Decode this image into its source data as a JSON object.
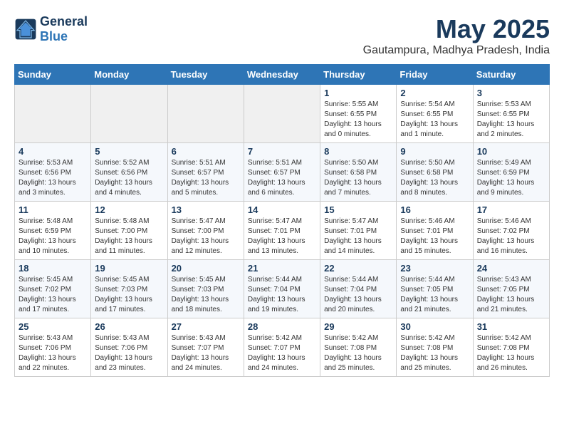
{
  "header": {
    "logo_line1": "General",
    "logo_line2": "Blue",
    "month": "May 2025",
    "location": "Gautampura, Madhya Pradesh, India"
  },
  "weekdays": [
    "Sunday",
    "Monday",
    "Tuesday",
    "Wednesday",
    "Thursday",
    "Friday",
    "Saturday"
  ],
  "weeks": [
    [
      {
        "day": "",
        "info": ""
      },
      {
        "day": "",
        "info": ""
      },
      {
        "day": "",
        "info": ""
      },
      {
        "day": "",
        "info": ""
      },
      {
        "day": "1",
        "info": "Sunrise: 5:55 AM\nSunset: 6:55 PM\nDaylight: 13 hours\nand 0 minutes."
      },
      {
        "day": "2",
        "info": "Sunrise: 5:54 AM\nSunset: 6:55 PM\nDaylight: 13 hours\nand 1 minute."
      },
      {
        "day": "3",
        "info": "Sunrise: 5:53 AM\nSunset: 6:55 PM\nDaylight: 13 hours\nand 2 minutes."
      }
    ],
    [
      {
        "day": "4",
        "info": "Sunrise: 5:53 AM\nSunset: 6:56 PM\nDaylight: 13 hours\nand 3 minutes."
      },
      {
        "day": "5",
        "info": "Sunrise: 5:52 AM\nSunset: 6:56 PM\nDaylight: 13 hours\nand 4 minutes."
      },
      {
        "day": "6",
        "info": "Sunrise: 5:51 AM\nSunset: 6:57 PM\nDaylight: 13 hours\nand 5 minutes."
      },
      {
        "day": "7",
        "info": "Sunrise: 5:51 AM\nSunset: 6:57 PM\nDaylight: 13 hours\nand 6 minutes."
      },
      {
        "day": "8",
        "info": "Sunrise: 5:50 AM\nSunset: 6:58 PM\nDaylight: 13 hours\nand 7 minutes."
      },
      {
        "day": "9",
        "info": "Sunrise: 5:50 AM\nSunset: 6:58 PM\nDaylight: 13 hours\nand 8 minutes."
      },
      {
        "day": "10",
        "info": "Sunrise: 5:49 AM\nSunset: 6:59 PM\nDaylight: 13 hours\nand 9 minutes."
      }
    ],
    [
      {
        "day": "11",
        "info": "Sunrise: 5:48 AM\nSunset: 6:59 PM\nDaylight: 13 hours\nand 10 minutes."
      },
      {
        "day": "12",
        "info": "Sunrise: 5:48 AM\nSunset: 7:00 PM\nDaylight: 13 hours\nand 11 minutes."
      },
      {
        "day": "13",
        "info": "Sunrise: 5:47 AM\nSunset: 7:00 PM\nDaylight: 13 hours\nand 12 minutes."
      },
      {
        "day": "14",
        "info": "Sunrise: 5:47 AM\nSunset: 7:01 PM\nDaylight: 13 hours\nand 13 minutes."
      },
      {
        "day": "15",
        "info": "Sunrise: 5:47 AM\nSunset: 7:01 PM\nDaylight: 13 hours\nand 14 minutes."
      },
      {
        "day": "16",
        "info": "Sunrise: 5:46 AM\nSunset: 7:01 PM\nDaylight: 13 hours\nand 15 minutes."
      },
      {
        "day": "17",
        "info": "Sunrise: 5:46 AM\nSunset: 7:02 PM\nDaylight: 13 hours\nand 16 minutes."
      }
    ],
    [
      {
        "day": "18",
        "info": "Sunrise: 5:45 AM\nSunset: 7:02 PM\nDaylight: 13 hours\nand 17 minutes."
      },
      {
        "day": "19",
        "info": "Sunrise: 5:45 AM\nSunset: 7:03 PM\nDaylight: 13 hours\nand 17 minutes."
      },
      {
        "day": "20",
        "info": "Sunrise: 5:45 AM\nSunset: 7:03 PM\nDaylight: 13 hours\nand 18 minutes."
      },
      {
        "day": "21",
        "info": "Sunrise: 5:44 AM\nSunset: 7:04 PM\nDaylight: 13 hours\nand 19 minutes."
      },
      {
        "day": "22",
        "info": "Sunrise: 5:44 AM\nSunset: 7:04 PM\nDaylight: 13 hours\nand 20 minutes."
      },
      {
        "day": "23",
        "info": "Sunrise: 5:44 AM\nSunset: 7:05 PM\nDaylight: 13 hours\nand 21 minutes."
      },
      {
        "day": "24",
        "info": "Sunrise: 5:43 AM\nSunset: 7:05 PM\nDaylight: 13 hours\nand 21 minutes."
      }
    ],
    [
      {
        "day": "25",
        "info": "Sunrise: 5:43 AM\nSunset: 7:06 PM\nDaylight: 13 hours\nand 22 minutes."
      },
      {
        "day": "26",
        "info": "Sunrise: 5:43 AM\nSunset: 7:06 PM\nDaylight: 13 hours\nand 23 minutes."
      },
      {
        "day": "27",
        "info": "Sunrise: 5:43 AM\nSunset: 7:07 PM\nDaylight: 13 hours\nand 24 minutes."
      },
      {
        "day": "28",
        "info": "Sunrise: 5:42 AM\nSunset: 7:07 PM\nDaylight: 13 hours\nand 24 minutes."
      },
      {
        "day": "29",
        "info": "Sunrise: 5:42 AM\nSunset: 7:08 PM\nDaylight: 13 hours\nand 25 minutes."
      },
      {
        "day": "30",
        "info": "Sunrise: 5:42 AM\nSunset: 7:08 PM\nDaylight: 13 hours\nand 25 minutes."
      },
      {
        "day": "31",
        "info": "Sunrise: 5:42 AM\nSunset: 7:08 PM\nDaylight: 13 hours\nand 26 minutes."
      }
    ]
  ]
}
